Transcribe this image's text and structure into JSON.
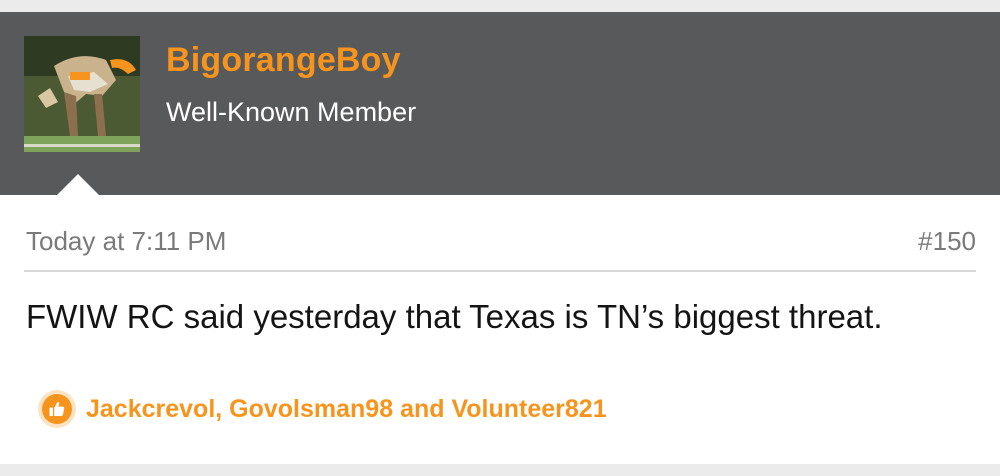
{
  "post": {
    "author": "BigorangeBoy",
    "author_title": "Well-Known Member",
    "timestamp": "Today at 7:11 PM",
    "post_number": "#150",
    "message": "FWIW RC said yesterday that Texas is TN’s biggest threat.",
    "likes_text": "Jackcrevol, Govolsman98 and Volunteer821"
  },
  "colors": {
    "header_bg": "#58595b",
    "accent_orange": "#f7941d",
    "meta_gray": "#7a7a7a"
  },
  "icons": {
    "like": "thumbs-up-icon"
  }
}
